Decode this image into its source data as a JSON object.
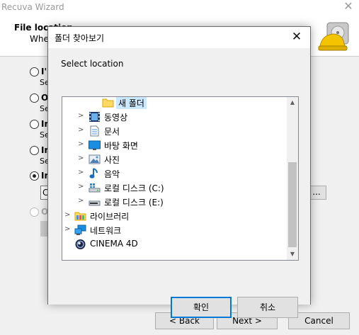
{
  "wizard": {
    "title": "Recuva Wizard",
    "close_glyph": "✕",
    "header_title": "File location",
    "header_subtitle": "Whe",
    "options": [
      {
        "label": "I'",
        "sub": "Se"
      },
      {
        "label": "O",
        "sub": "Se"
      },
      {
        "label": "In",
        "sub": "Se"
      },
      {
        "label": "In",
        "sub": "Se"
      },
      {
        "label": "In",
        "sub": ""
      },
      {
        "label": "O",
        "sub": ""
      }
    ],
    "path_value": "C",
    "browse_label": "...",
    "back_label": "< Back",
    "next_label": "Next >",
    "cancel_label": "Cancel"
  },
  "dialog": {
    "title": "폴더 찾아보기",
    "close_glyph": "✕",
    "prompt": "Select location",
    "tree": [
      {
        "label": "새 폴더",
        "icon": "folder-icon",
        "selected": true
      },
      {
        "label": "동영상",
        "icon": "video-icon"
      },
      {
        "label": "문서",
        "icon": "document-icon"
      },
      {
        "label": "바탕 화면",
        "icon": "desktop-icon"
      },
      {
        "label": "사진",
        "icon": "pictures-icon"
      },
      {
        "label": "음악",
        "icon": "music-icon"
      },
      {
        "label": "로컬 디스크 (C:)",
        "icon": "drive-c-icon"
      },
      {
        "label": "로컬 디스크 (E:)",
        "icon": "drive-icon"
      },
      {
        "label": "라이브러리",
        "icon": "library-icon"
      },
      {
        "label": "네트워크",
        "icon": "network-icon"
      },
      {
        "label": "CINEMA 4D",
        "icon": "cinema4d-icon"
      }
    ],
    "ok_label": "확인",
    "cancel_label": "취소"
  },
  "colors": {
    "accent": "#0078d7",
    "selection": "#cce8ff"
  }
}
